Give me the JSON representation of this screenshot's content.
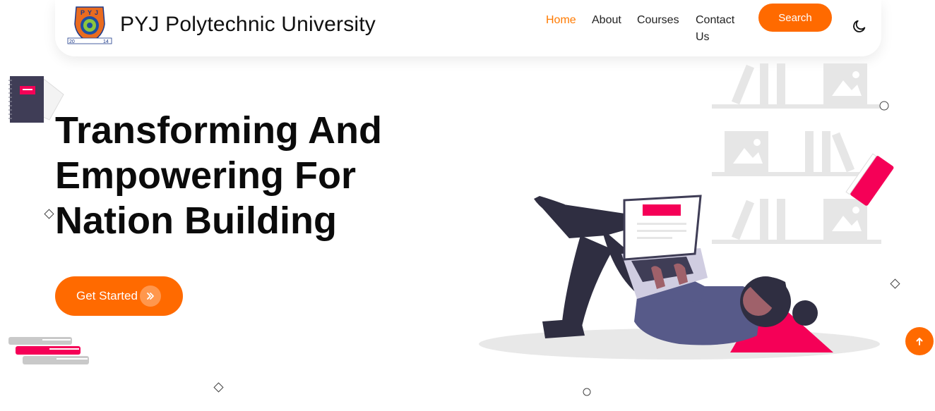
{
  "brand": {
    "name": "PYJ Polytechnic University",
    "logo_text": "PYJ",
    "logo_year_left": "20",
    "logo_year_right": "14"
  },
  "nav": {
    "items": [
      {
        "label": "Home",
        "active": true
      },
      {
        "label": "About",
        "active": false
      },
      {
        "label": "Courses",
        "active": false
      },
      {
        "label": "Contact Us",
        "active": false
      }
    ],
    "search_label": "Search",
    "theme_icon": "moon-icon"
  },
  "hero": {
    "title_lines": [
      "Transforming And",
      "Empowering For",
      "Nation Building"
    ],
    "cta_label": "Get Started",
    "cta_icon": "double-chevron-right-icon"
  },
  "scroll_top_icon": "arrow-up-icon",
  "colors": {
    "accent": "#ff6a00",
    "active_link": "#ff7a00",
    "illustration_pink": "#f50057",
    "illustration_dark": "#2f2e41",
    "illustration_purple": "#575a89"
  }
}
